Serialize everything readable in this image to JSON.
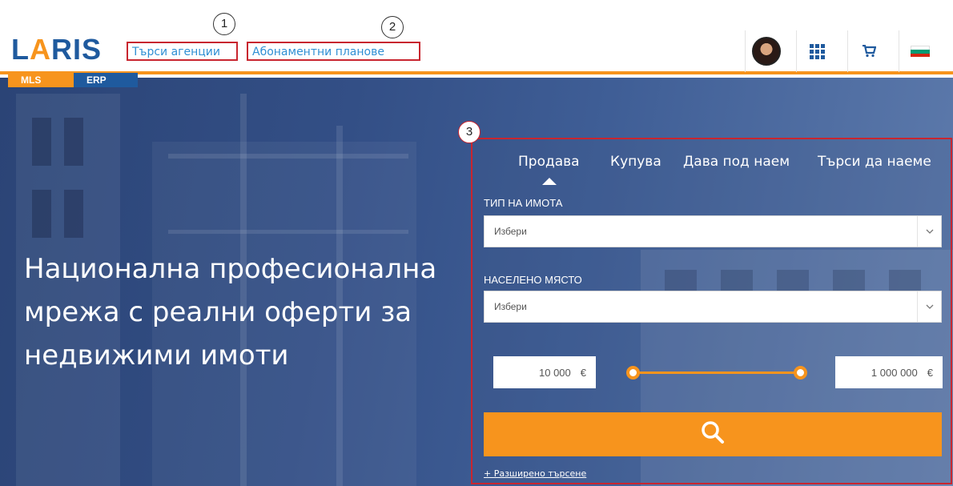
{
  "header": {
    "logo_text": "LARIS",
    "logo_tabs": [
      "MLS",
      "ERP"
    ],
    "nav": [
      {
        "label": "Търси агенции",
        "callout": "1"
      },
      {
        "label": "Абонаментни планове",
        "callout": "2"
      }
    ],
    "icons": [
      "user-avatar",
      "apps-grid-icon",
      "cart-icon",
      "bulgarian-flag-icon"
    ]
  },
  "hero": {
    "headline_lines": [
      "Национална професионална",
      "мрежа с реални оферти за",
      "недвижими имоти"
    ]
  },
  "search": {
    "callout": "3",
    "tabs": [
      "Продава",
      "Купува",
      "Дава под наем",
      "Търси да наеме"
    ],
    "active_tab_index": 0,
    "property_type_label": "ТИП НА ИМОТА",
    "property_type_value": "Избери",
    "location_label": "НАСЕЛЕНО МЯСТО",
    "location_value": "Избери",
    "price_min": "10 000",
    "price_max": "1 000 000",
    "currency": "€",
    "advanced_link": "+ Разширено търсене"
  },
  "colors": {
    "brand_blue": "#1f5a9e",
    "accent_orange": "#f7941d",
    "annotation_red": "#c8262f",
    "link_blue": "#2f8fd3"
  }
}
